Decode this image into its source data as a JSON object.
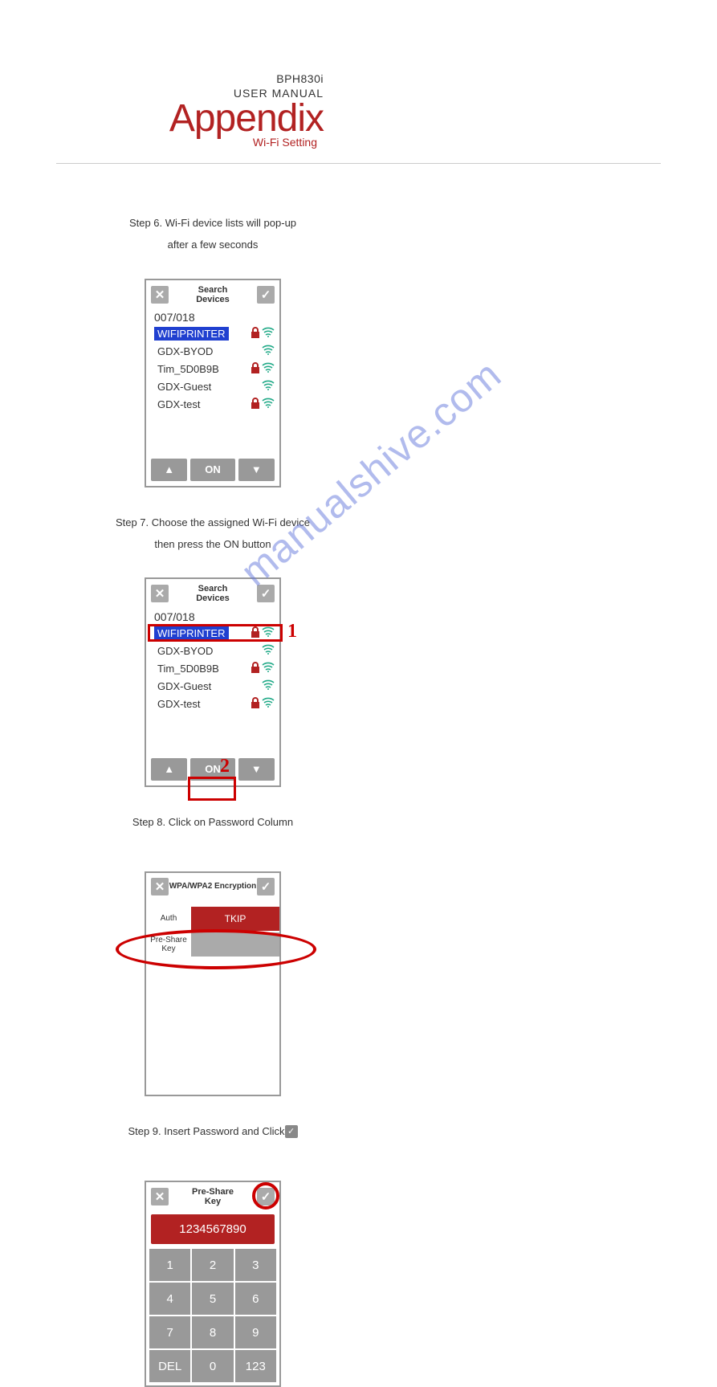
{
  "header": {
    "model": "BPH830i",
    "manual": "USER MANUAL",
    "title": "Appendix",
    "subtitle": "Wi-Fi Setting"
  },
  "steps": {
    "s6_l1": "Step 6. Wi-Fi device lists will pop-up",
    "s6_l2": "after a few seconds",
    "s7_l1": "Step 7. Choose the assigned Wi-Fi device",
    "s7_l2": "then press the ON button",
    "s8": "Step 8. Click on Password Column",
    "s9_prefix": "Step 9. Insert Password and Click"
  },
  "device_panel": {
    "title_l1": "Search",
    "title_l2": "Devices",
    "count": "007/018",
    "on_label": "ON",
    "networks": [
      {
        "name": "WIFIPRINTER",
        "locked": true,
        "selected": true
      },
      {
        "name": "GDX-BYOD",
        "locked": false,
        "selected": false
      },
      {
        "name": "Tim_5D0B9B",
        "locked": true,
        "selected": false
      },
      {
        "name": "GDX-Guest",
        "locked": false,
        "selected": false
      },
      {
        "name": "GDX-test",
        "locked": true,
        "selected": false
      }
    ]
  },
  "callouts": {
    "one": "1",
    "two": "2"
  },
  "encryption": {
    "title": "WPA/WPA2 Encryption",
    "auth_label": "Auth",
    "auth_value": "TKIP",
    "psk_label_l1": "Pre-Share",
    "psk_label_l2": "Key"
  },
  "keypad": {
    "title_l1": "Pre-Share",
    "title_l2": "Key",
    "display": "1234567890",
    "keys": [
      "1",
      "2",
      "3",
      "4",
      "5",
      "6",
      "7",
      "8",
      "9",
      "DEL",
      "0",
      "123"
    ]
  },
  "watermark": "manualshive.com"
}
